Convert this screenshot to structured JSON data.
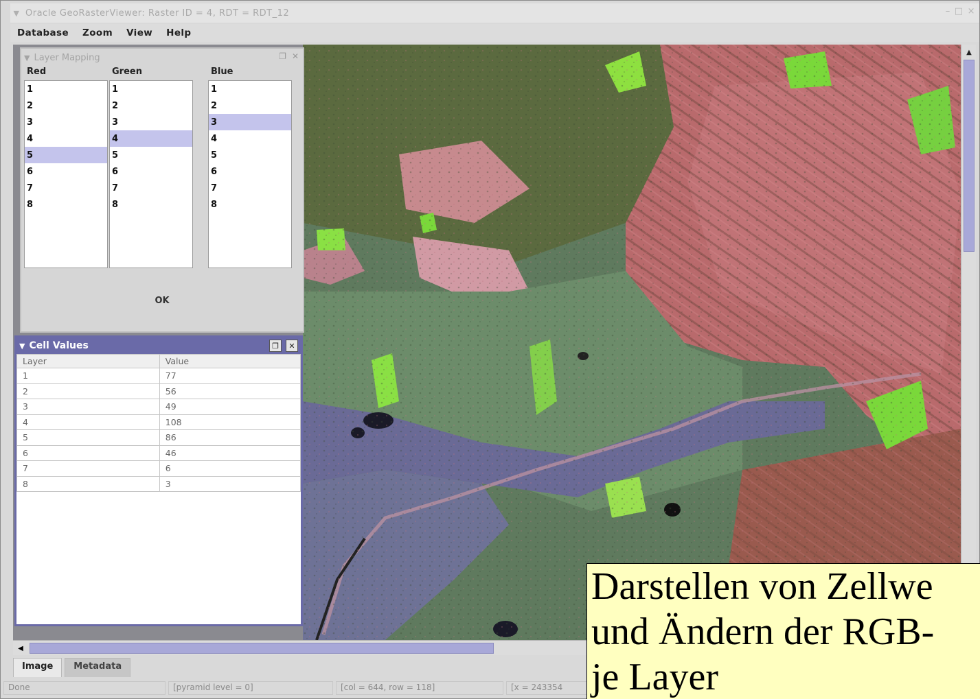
{
  "window": {
    "title": "Oracle GeoRasterViewer:    Raster ID = 4, RDT = RDT_12",
    "controls": [
      "–",
      "□",
      "×"
    ]
  },
  "menubar": {
    "items": [
      "Database",
      "Zoom",
      "View",
      "Help"
    ]
  },
  "layer_mapping": {
    "title": "Layer Mapping",
    "columns": [
      {
        "header": "Red",
        "options": [
          "1",
          "2",
          "3",
          "4",
          "5",
          "6",
          "7",
          "8"
        ],
        "selected": "5"
      },
      {
        "header": "Green",
        "options": [
          "1",
          "2",
          "3",
          "4",
          "5",
          "6",
          "7",
          "8"
        ],
        "selected": "4"
      },
      {
        "header": "Blue",
        "options": [
          "1",
          "2",
          "3",
          "4",
          "5",
          "6",
          "7",
          "8"
        ],
        "selected": "3"
      }
    ],
    "ok_label": "OK"
  },
  "cell_values": {
    "title": "Cell Values",
    "headers": [
      "Layer",
      "Value"
    ],
    "rows": [
      [
        "1",
        "77"
      ],
      [
        "2",
        "56"
      ],
      [
        "3",
        "49"
      ],
      [
        "4",
        "108"
      ],
      [
        "5",
        "86"
      ],
      [
        "6",
        "46"
      ],
      [
        "7",
        "6"
      ],
      [
        "8",
        "3"
      ]
    ]
  },
  "tabs": {
    "image": "Image",
    "metadata": "Metadata"
  },
  "statusbar": {
    "status": "Done",
    "pyramid": "[pyramid level = 0]",
    "colrow": "[col = 644, row = 118]",
    "coords": "[x = 243354"
  },
  "caption": {
    "lines": [
      "Darstellen von Zellwe",
      "und Ändern der RGB-",
      "je Layer"
    ]
  },
  "colors": {
    "frame_active": "#6a6aa8",
    "selection": "#c4c4ec",
    "caption_bg": "#ffffc0"
  }
}
